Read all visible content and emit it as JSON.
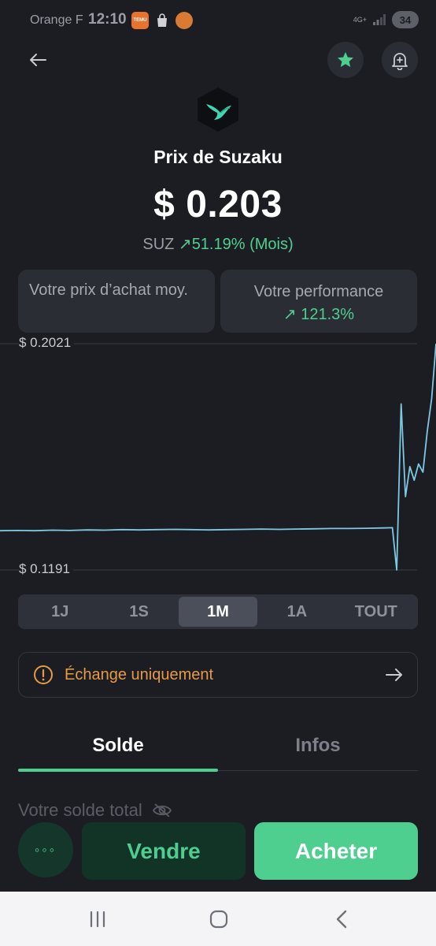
{
  "status_bar": {
    "carrier": "Orange F",
    "time": "12:10",
    "app_icons": [
      "temu-icon",
      "shopping-bag-icon",
      "burger-king-icon"
    ],
    "temu_label": "TEMU",
    "network": "4G+",
    "battery": "34"
  },
  "header": {
    "coin_title": "Prix de Suzaku",
    "price": "$ 0.203",
    "ticker": "SUZ",
    "change_arrow": "↗",
    "change_value": "51.19% (Mois)"
  },
  "cards": {
    "avg_price_label": "Votre prix d’achat moy.",
    "performance_label": "Votre performance",
    "performance_arrow": "↗",
    "performance_value": "121.3%"
  },
  "chart_data": {
    "type": "line",
    "max_label": "$ 0.2021",
    "min_label": "$ 0.1191",
    "ylim": [
      0.1191,
      0.2021
    ],
    "x": [
      0,
      4,
      8,
      12,
      16,
      20,
      24,
      28,
      32,
      36,
      40,
      44,
      48,
      52,
      56,
      60,
      64,
      68,
      72,
      76,
      80,
      84,
      88,
      90,
      91,
      92,
      93,
      94,
      95,
      96,
      97,
      98,
      99,
      100
    ],
    "values": [
      0.1335,
      0.1336,
      0.1335,
      0.1337,
      0.1336,
      0.1338,
      0.1337,
      0.1339,
      0.1338,
      0.1339,
      0.134,
      0.1339,
      0.1338,
      0.1339,
      0.134,
      0.1341,
      0.134,
      0.1341,
      0.1342,
      0.1343,
      0.1343,
      0.1344,
      0.1345,
      0.1346,
      0.1191,
      0.18,
      0.146,
      0.157,
      0.152,
      0.158,
      0.155,
      0.17,
      0.182,
      0.2021
    ],
    "series_color": "#7ec8e3",
    "grid": "top-and-bottom-lines-only"
  },
  "ranges": {
    "options": [
      "1J",
      "1S",
      "1M",
      "1A",
      "TOUT"
    ],
    "selected": "1M"
  },
  "notice": {
    "text": "Échange uniquement",
    "color": "#e69a45"
  },
  "tabs": {
    "items": [
      "Solde",
      "Infos"
    ],
    "active": "Solde"
  },
  "balance": {
    "label": "Votre solde total"
  },
  "actions": {
    "more": "◦◦◦",
    "sell": "Vendre",
    "buy": "Acheter",
    "accent": "#4fcf8f"
  },
  "nav": [
    "recent-apps-icon",
    "home-icon",
    "back-icon"
  ]
}
